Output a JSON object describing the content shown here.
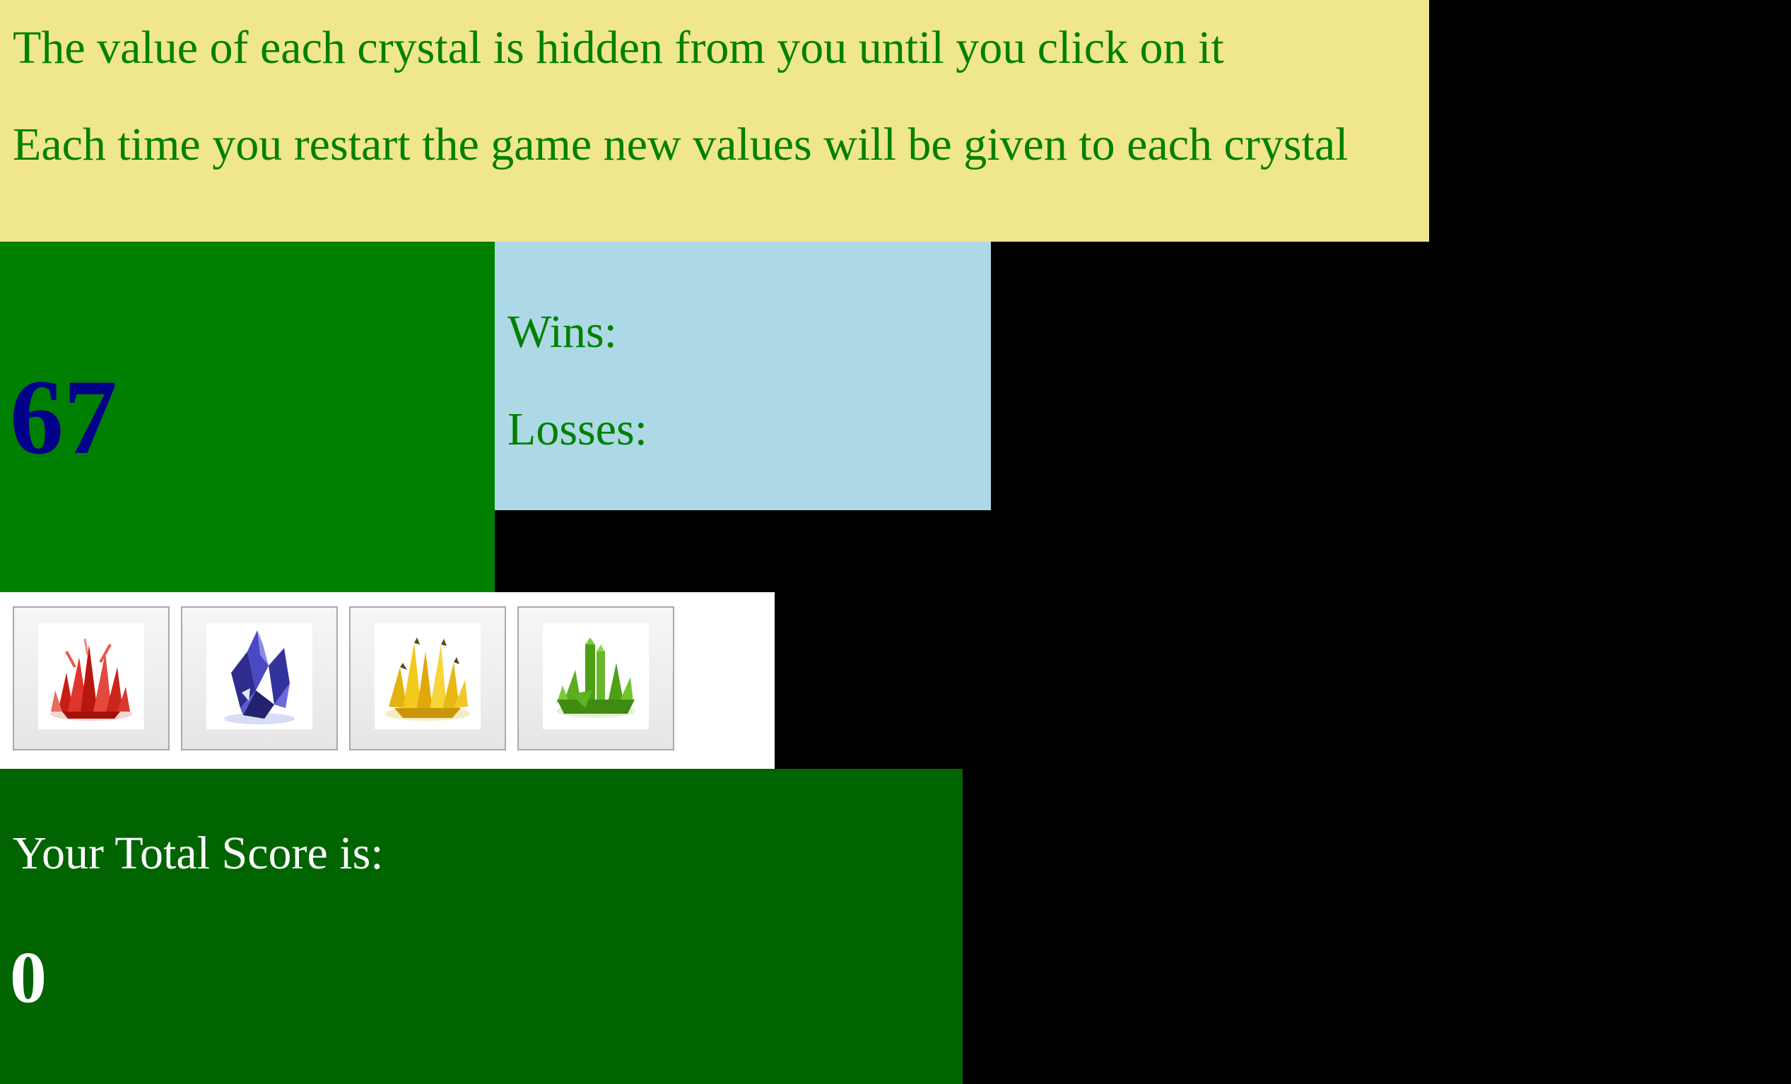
{
  "instructions": {
    "line1": "The value of each crystal is hidden from you until you click on it",
    "line2": "Each time you restart the game new values will be given to each crystal"
  },
  "target": {
    "number": "67"
  },
  "stats": {
    "wins_label": "Wins:",
    "losses_label": "Losses:"
  },
  "crystals": [
    {
      "name": "red-crystal",
      "color": "#d42a1e"
    },
    {
      "name": "blue-crystal",
      "color": "#3b3aa8"
    },
    {
      "name": "yellow-crystal",
      "color": "#f0c419"
    },
    {
      "name": "green-crystal",
      "color": "#5aac1f"
    }
  ],
  "score": {
    "label": "Your Total Score is:",
    "value": "0"
  },
  "colors": {
    "instructions_bg": "#f0e68c",
    "instructions_text": "#008000",
    "target_bg": "#008000",
    "target_text": "#00008b",
    "stats_bg": "#add8e6",
    "stats_text": "#008000",
    "crystals_bg": "#ffffff",
    "score_bg": "#006400",
    "score_text": "#ffffff",
    "page_bg": "#000000"
  }
}
